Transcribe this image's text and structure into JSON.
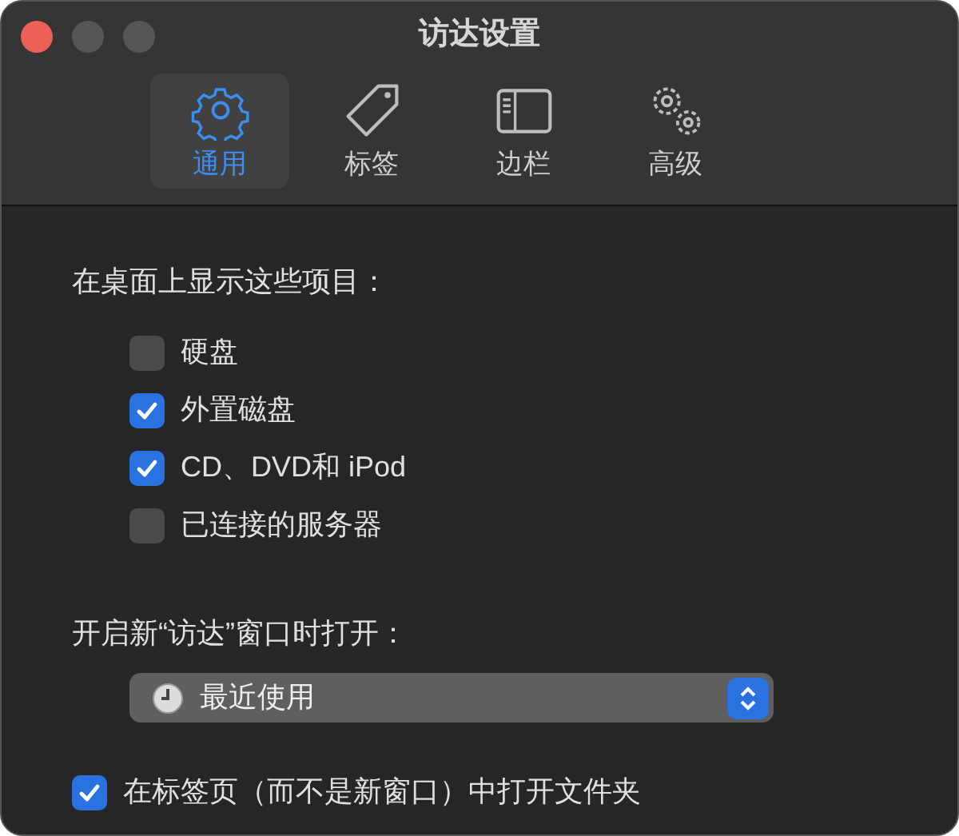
{
  "window": {
    "title": "访达设置"
  },
  "tabs": [
    {
      "label": "通用",
      "kind": "gear",
      "selected": true
    },
    {
      "label": "标签",
      "kind": "tag",
      "selected": false
    },
    {
      "label": "边栏",
      "kind": "sidebar",
      "selected": false
    },
    {
      "label": "高级",
      "kind": "gears",
      "selected": false
    }
  ],
  "desktop_section": {
    "heading": "在桌面上显示这些项目：",
    "items": [
      {
        "label": "硬盘",
        "checked": false
      },
      {
        "label": "外置磁盘",
        "checked": true
      },
      {
        "label": "CD、DVD和 iPod",
        "checked": true
      },
      {
        "label": "已连接的服务器",
        "checked": false
      }
    ]
  },
  "new_window": {
    "label": "开启新“访达”窗口时打开：",
    "value": "最近使用"
  },
  "open_in_tabs": {
    "label": "在标签页（而不是新窗口）中打开文件夹",
    "checked": true
  }
}
